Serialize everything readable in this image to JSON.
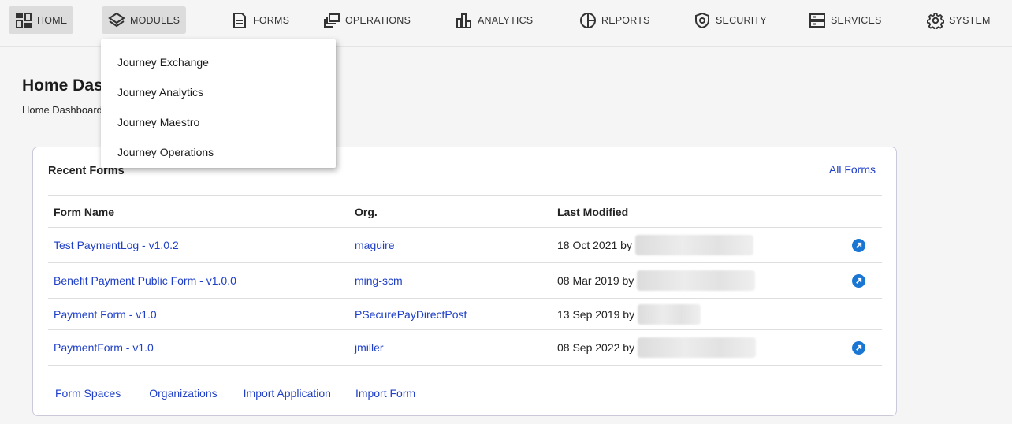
{
  "nav": {
    "items": [
      {
        "label": "HOME",
        "icon": "dashboard-icon"
      },
      {
        "label": "MODULES",
        "icon": "layers-icon"
      },
      {
        "label": "FORMS",
        "icon": "form-icon"
      },
      {
        "label": "OPERATIONS",
        "icon": "stacked-windows-icon"
      },
      {
        "label": "ANALYTICS",
        "icon": "bar-chart-icon"
      },
      {
        "label": "REPORTS",
        "icon": "pie-chart-icon"
      },
      {
        "label": "SECURITY",
        "icon": "shield-icon"
      },
      {
        "label": "SERVICES",
        "icon": "server-icon"
      },
      {
        "label": "SYSTEM",
        "icon": "gear-icon"
      }
    ]
  },
  "modules_menu": {
    "items": [
      "Journey Exchange",
      "Journey Analytics",
      "Journey Maestro",
      "Journey Operations"
    ]
  },
  "page": {
    "title": "Home Dashboard",
    "breadcrumb": "Home Dashboard"
  },
  "recent_forms": {
    "title": "Recent Forms",
    "all_forms_link": "All Forms",
    "columns": [
      "Form Name",
      "Org.",
      "Last Modified"
    ],
    "rows": [
      {
        "name": "Test PaymentLog  -  v1.0.2",
        "org": "maguire",
        "modified": "18 Oct 2021 by",
        "action": true
      },
      {
        "name": "Benefit Payment Public Form  -  v1.0.0",
        "org": "ming-scm",
        "modified": "08 Mar 2019 by",
        "action": true
      },
      {
        "name": "Payment Form  -  v1.0",
        "org": "PSecurePayDirectPost",
        "modified": "13 Sep 2019 by",
        "action": false
      },
      {
        "name": "PaymentForm  -  v1.0",
        "org": "jmiller",
        "modified": "08 Sep 2022 by",
        "action": true
      }
    ],
    "footer_links": [
      "Form Spaces",
      "Organizations",
      "Import Application",
      "Import Form"
    ]
  },
  "colors": {
    "link": "#1f3fc7",
    "action_icon": "#1976d2",
    "nav_active": "#dcdcdc"
  }
}
